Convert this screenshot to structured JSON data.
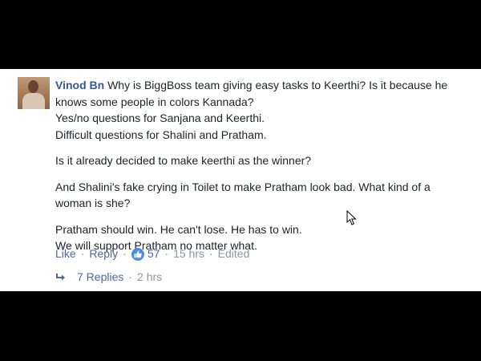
{
  "comment": {
    "author": "Vinod Bn",
    "paragraphs": [
      [
        "Why is BiggBoss team giving easy tasks to Keerthi? Is it because he knows some people in colors Kannada?",
        "Yes/no questions for Sanjana and Keerthi.",
        "Difficult questions for Shalini and Pratham."
      ],
      [
        "Is it already decided to make keerthi as the winner?"
      ],
      [
        "And Shalini's fake crying in Toilet to make Pratham look bad. What kind of a woman is she?"
      ],
      [
        "Pratham should win. He can't lose. He has to win.",
        "We will support Pratham no matter what."
      ]
    ],
    "actions": {
      "like": "Like",
      "reply": "Reply",
      "reaction_count": "57",
      "time": "15 hrs",
      "edited": "Edited"
    },
    "replies": {
      "label": "7 Replies",
      "time": "2 hrs"
    }
  },
  "colors": {
    "author": "#365899",
    "link": "#4b67a1",
    "meta": "#90949c",
    "text": "#1d2129",
    "like_badge": "#4a8fe2"
  },
  "icons": {
    "avatar": "profile-photo",
    "reaction": "thumbs-up-icon",
    "reply_arrow": "reply-arrow-icon",
    "cursor": "mouse-pointer-icon"
  }
}
